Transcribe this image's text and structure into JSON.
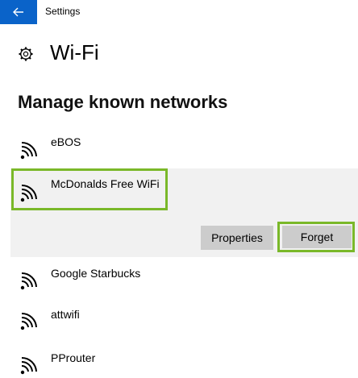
{
  "window": {
    "app_title": "Settings"
  },
  "header": {
    "title": "Wi-Fi"
  },
  "section": {
    "title": "Manage known networks"
  },
  "networks": [
    {
      "name": "eBOS"
    },
    {
      "name": "McDonalds Free WiFi",
      "selected": true
    },
    {
      "name": "Google Starbucks"
    },
    {
      "name": "attwifi"
    },
    {
      "name": "PProuter"
    }
  ],
  "actions": {
    "properties_label": "Properties",
    "forget_label": "Forget"
  },
  "colors": {
    "accent": "#0a63c9",
    "highlight": "#7ab829",
    "button_bg": "#cccccc",
    "selected_bg": "#f1f1f1"
  },
  "icons": {
    "back": "back-arrow-icon",
    "settings": "gear-icon",
    "network": "wifi-icon"
  }
}
